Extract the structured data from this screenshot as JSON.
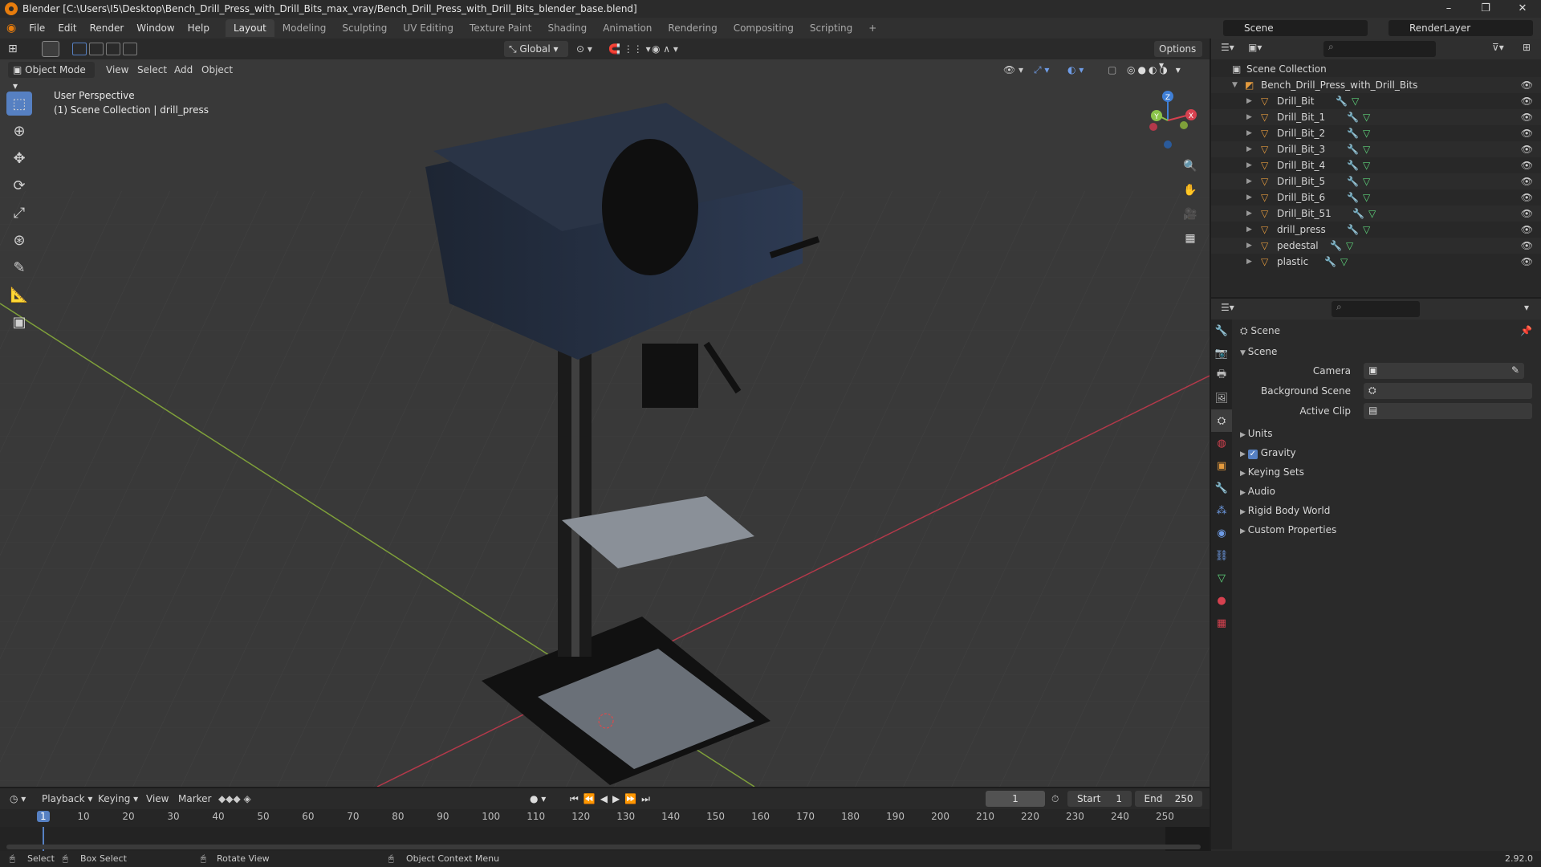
{
  "window": {
    "title": "Blender [C:\\Users\\I5\\Desktop\\Bench_Drill_Press_with_Drill_Bits_max_vray/Bench_Drill_Press_with_Drill_Bits_blender_base.blend]",
    "controls": [
      "–",
      "❐",
      "✕"
    ]
  },
  "menubar": {
    "items": [
      "File",
      "Edit",
      "Render",
      "Window",
      "Help"
    ],
    "workspaces": [
      "Layout",
      "Modeling",
      "Sculpting",
      "UV Editing",
      "Texture Paint",
      "Shading",
      "Animation",
      "Rendering",
      "Compositing",
      "Scripting"
    ],
    "active_workspace": "Layout",
    "add_tab": "+",
    "scene_label": "Scene",
    "render_layer": "RenderLayer"
  },
  "viewport_header": {
    "transform_orientation": "Global",
    "options_label": "Options",
    "mode": "Object Mode",
    "menus": [
      "View",
      "Select",
      "Add",
      "Object"
    ]
  },
  "viewport": {
    "perspective": "User Perspective",
    "collection_info": "(1) Scene Collection | drill_press",
    "gizmo_axes": [
      "Z",
      "Y",
      "X"
    ]
  },
  "outliner": {
    "root": "Scene Collection",
    "collection": "Bench_Drill_Press_with_Drill_Bits",
    "objects": [
      "Drill_Bit",
      "Drill_Bit_1",
      "Drill_Bit_2",
      "Drill_Bit_3",
      "Drill_Bit_4",
      "Drill_Bit_5",
      "Drill_Bit_6",
      "Drill_Bit_51",
      "drill_press",
      "pedestal",
      "plastic"
    ]
  },
  "properties": {
    "context": "Scene",
    "panel": "Scene",
    "fields": [
      {
        "label": "Camera",
        "value": ""
      },
      {
        "label": "Background Scene",
        "value": ""
      },
      {
        "label": "Active Clip",
        "value": ""
      }
    ],
    "subpanels": [
      "Units",
      "Gravity",
      "Keying Sets",
      "Audio",
      "Rigid Body World",
      "Custom Properties"
    ],
    "gravity_checked": true
  },
  "timeline": {
    "menus": [
      "Playback",
      "Keying",
      "View",
      "Marker"
    ],
    "current_frame": "1",
    "start_label": "Start",
    "start": "1",
    "end_label": "End",
    "end": "250",
    "ticks": [
      "1",
      "10",
      "20",
      "30",
      "40",
      "50",
      "60",
      "70",
      "80",
      "90",
      "100",
      "110",
      "120",
      "130",
      "140",
      "150",
      "160",
      "170",
      "180",
      "190",
      "200",
      "210",
      "220",
      "230",
      "240",
      "250"
    ]
  },
  "statusbar": {
    "select": "Select",
    "box_select": "Box Select",
    "rotate_view": "Rotate View",
    "context_menu": "Object Context Menu",
    "version": "2.92.0"
  },
  "colors": {
    "accent": "#5680c2",
    "object_orange": "#e39a3e",
    "mesh_green": "#5fd67c",
    "modifier_blue": "#6f9de8",
    "axis_x": "#d6414f",
    "axis_y": "#8bc34a",
    "axis_z": "#3f7fd6"
  }
}
